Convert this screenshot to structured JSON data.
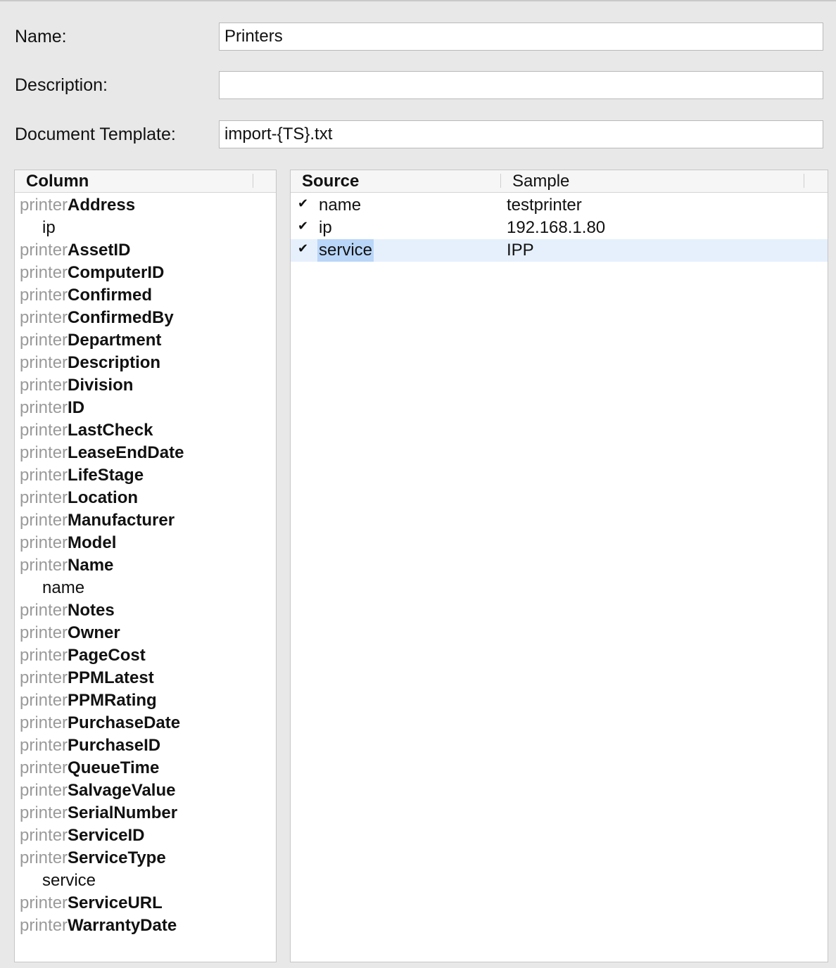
{
  "form": {
    "name_label": "Name:",
    "name_value": "Printers",
    "description_label": "Description:",
    "description_value": "",
    "template_label": "Document Template:",
    "template_value": "import-{TS}.txt"
  },
  "column_table": {
    "header": "Column",
    "rows": [
      {
        "prefix": "printer",
        "field": "Address"
      },
      {
        "child": "ip"
      },
      {
        "prefix": "printer",
        "field": "AssetID"
      },
      {
        "prefix": "printer",
        "field": "ComputerID"
      },
      {
        "prefix": "printer",
        "field": "Confirmed"
      },
      {
        "prefix": "printer",
        "field": "ConfirmedBy"
      },
      {
        "prefix": "printer",
        "field": "Department"
      },
      {
        "prefix": "printer",
        "field": "Description"
      },
      {
        "prefix": "printer",
        "field": "Division"
      },
      {
        "prefix": "printer",
        "field": "ID"
      },
      {
        "prefix": "printer",
        "field": "LastCheck"
      },
      {
        "prefix": "printer",
        "field": "LeaseEndDate"
      },
      {
        "prefix": "printer",
        "field": "LifeStage"
      },
      {
        "prefix": "printer",
        "field": "Location"
      },
      {
        "prefix": "printer",
        "field": "Manufacturer"
      },
      {
        "prefix": "printer",
        "field": "Model"
      },
      {
        "prefix": "printer",
        "field": "Name"
      },
      {
        "child": "name"
      },
      {
        "prefix": "printer",
        "field": "Notes"
      },
      {
        "prefix": "printer",
        "field": "Owner"
      },
      {
        "prefix": "printer",
        "field": "PageCost"
      },
      {
        "prefix": "printer",
        "field": "PPMLatest"
      },
      {
        "prefix": "printer",
        "field": "PPMRating"
      },
      {
        "prefix": "printer",
        "field": "PurchaseDate"
      },
      {
        "prefix": "printer",
        "field": "PurchaseID"
      },
      {
        "prefix": "printer",
        "field": "QueueTime"
      },
      {
        "prefix": "printer",
        "field": "SalvageValue"
      },
      {
        "prefix": "printer",
        "field": "SerialNumber"
      },
      {
        "prefix": "printer",
        "field": "ServiceID"
      },
      {
        "prefix": "printer",
        "field": "ServiceType"
      },
      {
        "child": "service"
      },
      {
        "prefix": "printer",
        "field": "ServiceURL"
      },
      {
        "prefix": "printer",
        "field": "WarrantyDate"
      }
    ]
  },
  "source_table": {
    "header_source": "Source",
    "header_sample": "Sample",
    "check_glyph": "✔",
    "rows": [
      {
        "source": "name",
        "sample": "testprinter",
        "checked": true,
        "selected": false
      },
      {
        "source": "ip",
        "sample": "192.168.1.80",
        "checked": true,
        "selected": false
      },
      {
        "source": "service",
        "sample": "IPP",
        "checked": true,
        "selected": true
      }
    ]
  }
}
